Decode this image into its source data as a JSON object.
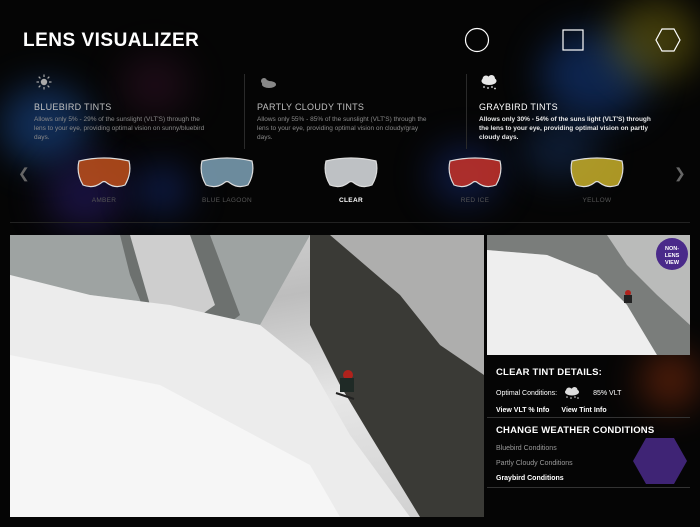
{
  "header": {
    "title": "LENS VISUALIZER"
  },
  "tints": [
    {
      "name": "BLUEBIRD TINTS",
      "description": "Allows only 5% - 29% of the sunslight (VLT'S) through the lens to your eye, providing optimal vision on sunny/bluebird days.",
      "icon": "sun-icon"
    },
    {
      "name": "PARTLY CLOUDY TINTS",
      "description": "Allows only 55% - 85% of the sunslight (VLT'S) through the lens to your eye, providing optimal vision on cloudy/gray days.",
      "icon": "partly-cloudy-icon"
    },
    {
      "name": "GRAYBIRD TINTS",
      "description": "Allows only 30% - 54% of the suns light (VLT'S) through the lens to your eye, providing optimal vision on partly cloudy days.",
      "icon": "cloud-snow-icon"
    }
  ],
  "lenses": [
    {
      "name": "AMBER",
      "color": "#c0501a"
    },
    {
      "name": "BLUE LAGOON",
      "color": "#7fa3b8"
    },
    {
      "name": "CLEAR",
      "color": "#dfe3e6"
    },
    {
      "name": "RED ICE",
      "color": "#c8322a"
    },
    {
      "name": "YELLOW",
      "color": "#c9b02a"
    }
  ],
  "selected_lens": "CLEAR",
  "badge": {
    "line1": "NON-",
    "line2": "LENS",
    "line3": "VIEW"
  },
  "details": {
    "title": "CLEAR TINT DETAILS:",
    "optimal_label": "Optimal Conditions:",
    "vlt": "85% VLT",
    "vlt_info": "View VLT % Info",
    "tint_info": "View Tint Info"
  },
  "weather": {
    "title": "CHANGE WEATHER CONDITIONS",
    "options": [
      "Bluebird Conditions",
      "Partly Cloudy Conditions",
      "Graybird Conditions"
    ],
    "selected": "Graybird Conditions"
  },
  "colors": {
    "background": "#050505",
    "accent_purple": "#4a2a8a"
  }
}
